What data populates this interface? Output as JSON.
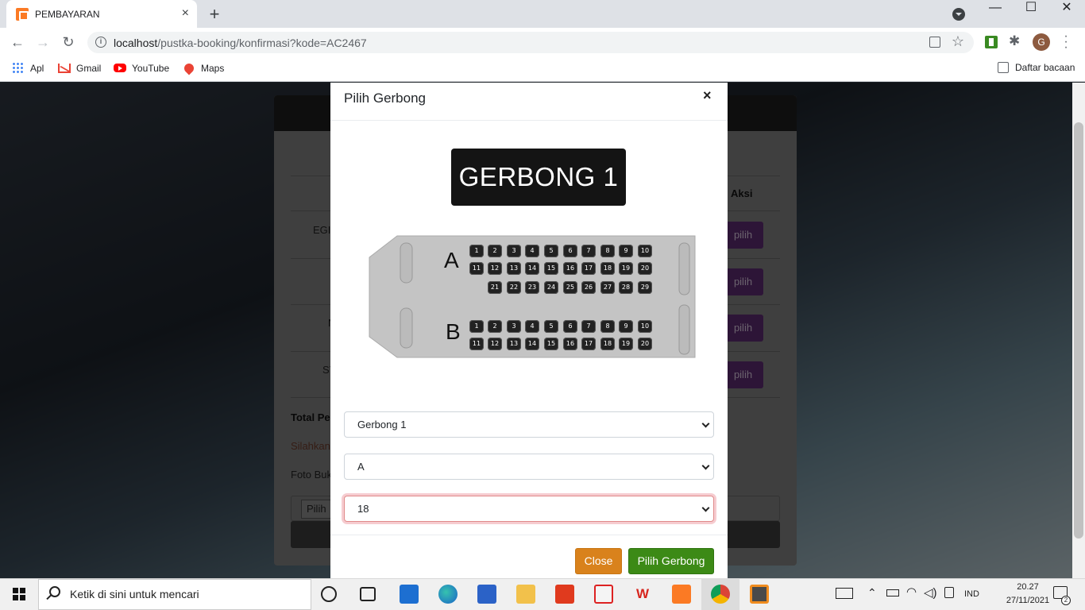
{
  "browser": {
    "tab_title": "PEMBAYARAN",
    "tab_close": "×",
    "new_tab": "+",
    "win_min": "—",
    "win_max": "☐",
    "win_close": "✕",
    "url_host": "localhost",
    "url_path": "/pustka-booking/konfirmasi?kode=AC2467",
    "profile_initial": "G",
    "bookmarks": [
      "Apl",
      "Gmail",
      "YouTube",
      "Maps"
    ],
    "reading_list": "Daftar bacaan"
  },
  "background_page": {
    "column_aksi": "Aksi",
    "row_fragments": [
      "EGI(",
      "N",
      "SY"
    ],
    "pilih_label": "pilih",
    "total_label": "Total Pe",
    "silahkan_text": "Silahkan",
    "foto_label": "Foto Buk",
    "file_button": "Pilih"
  },
  "modal": {
    "title": "Pilih Gerbong",
    "close_symbol": "×",
    "banner": "GERBONG 1",
    "row_a_label": "A",
    "row_b_label": "B",
    "seats_a": [
      1,
      2,
      3,
      4,
      5,
      6,
      7,
      8,
      9,
      10,
      11,
      12,
      13,
      14,
      15,
      16,
      17,
      18,
      19,
      20,
      21,
      22,
      23,
      24,
      25,
      26,
      27,
      28,
      29
    ],
    "seats_b": [
      1,
      2,
      3,
      4,
      5,
      6,
      7,
      8,
      9,
      10,
      11,
      12,
      13,
      14,
      15,
      16,
      17,
      18,
      19,
      20
    ],
    "select_gerbong": "Gerbong 1",
    "select_row": "A",
    "select_seat": "18",
    "btn_close": "Close",
    "btn_submit": "Pilih Gerbong"
  },
  "taskbar": {
    "search_placeholder": "Ketik di sini untuk mencari",
    "language": "IND",
    "time": "20.27",
    "date": "27/11/2021",
    "notification_count": "2"
  },
  "colors": {
    "accent_orange": "#d9821c",
    "accent_green": "#3c8a16",
    "pilih_purple": "#5b2a6e"
  }
}
